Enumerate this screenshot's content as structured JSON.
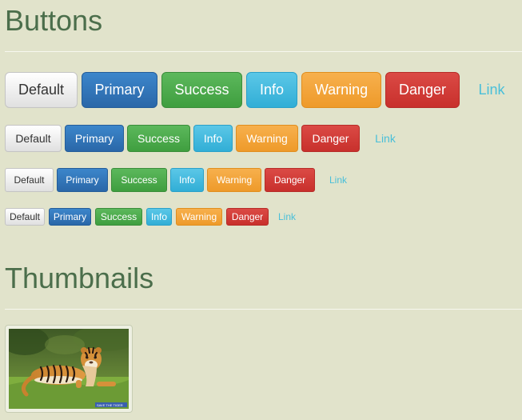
{
  "sections": {
    "buttons_title": "Buttons",
    "thumbnails_title": "Thumbnails"
  },
  "buttons": {
    "default": "Default",
    "primary": "Primary",
    "success": "Success",
    "info": "Info",
    "warning": "Warning",
    "danger": "Danger",
    "link": "Link"
  },
  "thumbnail": {
    "caption_strip": "SAVE THE TIGER"
  }
}
